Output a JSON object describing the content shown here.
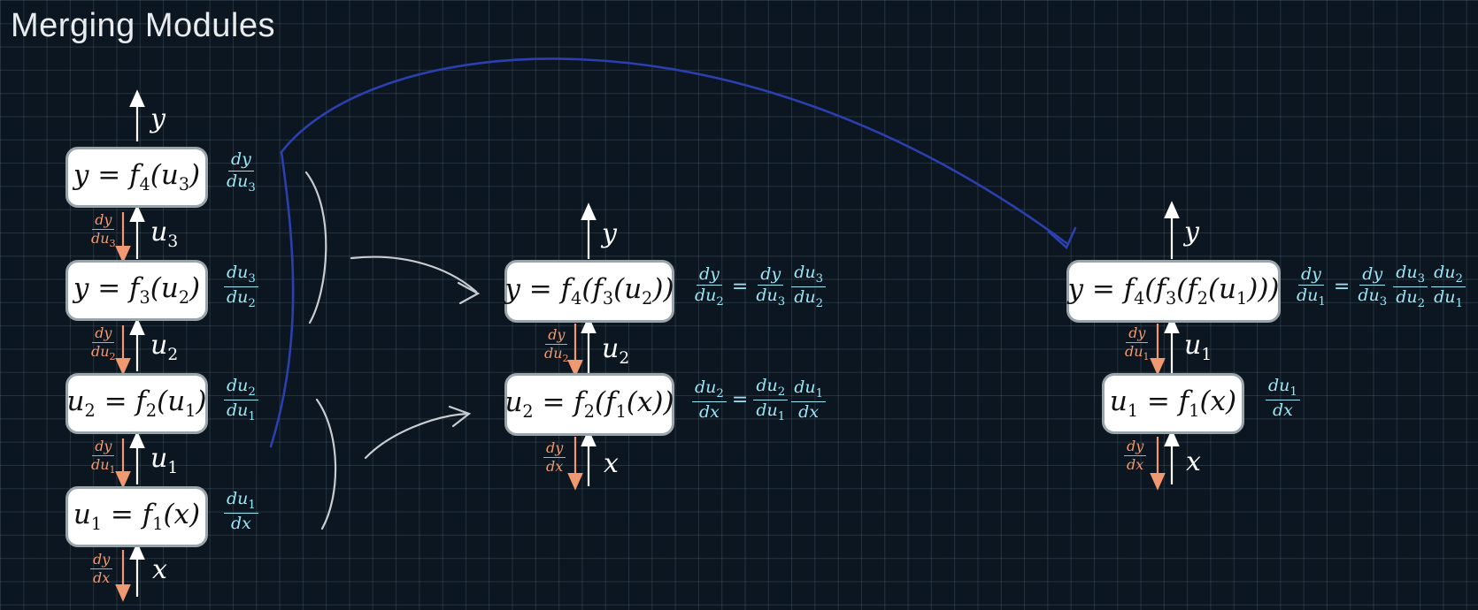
{
  "title": "Merging Modules",
  "colors": {
    "forward_arrow": "#ffffff",
    "backward_arrow": "#f09870",
    "derivative": "#9be6f6",
    "annotation": "#2b3fae"
  },
  "left_column": {
    "top_output": "y",
    "modules": [
      {
        "prefix": "y = f",
        "fsub": "4",
        "arg": "u",
        "asub": "3"
      },
      {
        "prefix": "y = f",
        "fsub": "3",
        "arg": "u",
        "asub": "2"
      },
      {
        "prefix": "u",
        "prefix_sub": "2",
        "fsub": "2",
        "arg": "u",
        "asub": "1"
      },
      {
        "prefix": "u",
        "prefix_sub": "1",
        "fsub": "1",
        "arg": "x"
      }
    ],
    "local_derivs": [
      {
        "num": "dy",
        "den": "du",
        "den_sub": "3"
      },
      {
        "num": "du",
        "num_sub": "3",
        "den": "du",
        "den_sub": "2"
      },
      {
        "num": "du",
        "num_sub": "2",
        "den": "du",
        "den_sub": "1"
      },
      {
        "num": "du",
        "num_sub": "1",
        "den": "dx"
      }
    ],
    "connections": [
      {
        "var": "u",
        "sub": "3",
        "grad_num": "dy",
        "grad_den": "du",
        "grad_sub": "3"
      },
      {
        "var": "u",
        "sub": "2",
        "grad_num": "dy",
        "grad_den": "du",
        "grad_sub": "2"
      },
      {
        "var": "u",
        "sub": "1",
        "grad_num": "dy",
        "grad_den": "du",
        "grad_sub": "1"
      },
      {
        "var": "x",
        "grad_num": "dy",
        "grad_den": "dx"
      }
    ]
  },
  "middle_column": {
    "top_output": "y",
    "modules": [
      "y = f4(f3(u2))",
      "u2 = f2(f1(x))"
    ],
    "connections": [
      {
        "var": "u",
        "sub": "2",
        "grad_num": "dy",
        "grad_den": "du",
        "grad_sub": "2"
      },
      {
        "var": "x",
        "grad_num": "dy",
        "grad_den": "dx"
      }
    ],
    "equations": [
      "dy/du2 = dy/du3 · du3/du2",
      "du2/dx = du2/du1 · du1/dx"
    ]
  },
  "right_column": {
    "top_output": "y",
    "modules": [
      "y = f4(f3(f2(u1)))",
      "u1 = f1(x)"
    ],
    "connections": [
      {
        "var": "u",
        "sub": "1",
        "grad_num": "dy",
        "grad_den": "du",
        "grad_sub": "1"
      },
      {
        "var": "x",
        "grad_num": "dy",
        "grad_den": "dx"
      }
    ],
    "equations": [
      "dy/du1 = dy/du3 · du3/du2 · du2/du1",
      "du1/dx"
    ]
  }
}
